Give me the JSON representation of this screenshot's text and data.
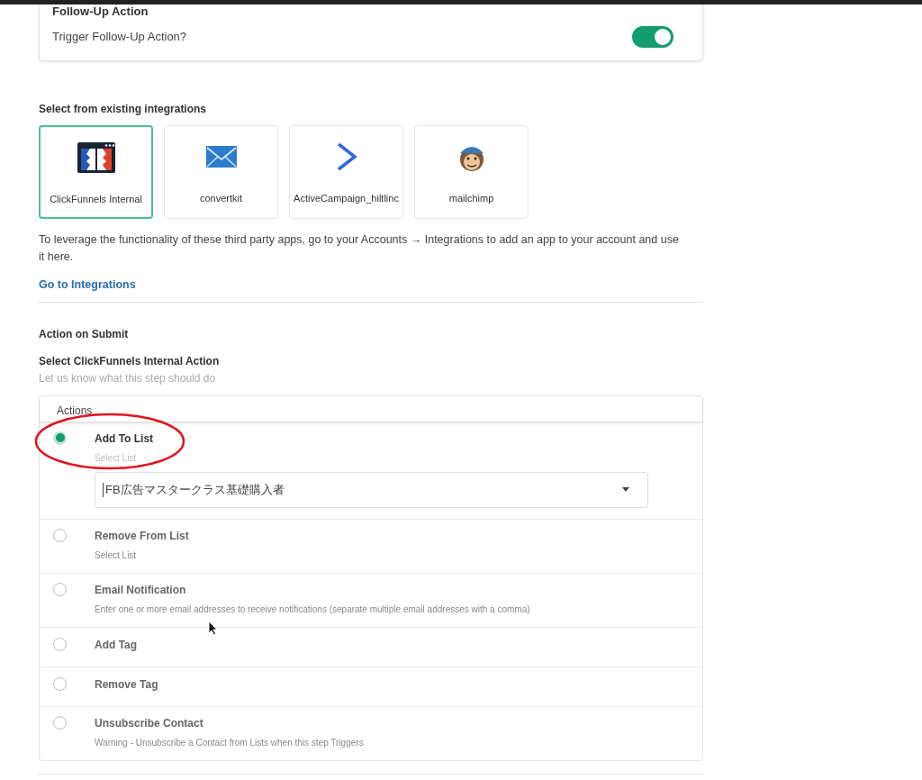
{
  "follow_up": {
    "heading": "Follow-Up Action",
    "label": "Trigger Follow-Up Action?",
    "on": true
  },
  "integrations": {
    "heading": "Select from existing integrations",
    "items": [
      {
        "name": "ClickFunnels Internal",
        "kind": "clickfunnels",
        "selected": true
      },
      {
        "name": "convertkit",
        "kind": "envelope",
        "selected": false
      },
      {
        "name": "ActiveCampaign_hiltlinc",
        "kind": "chevron",
        "selected": false
      },
      {
        "name": "mailchimp",
        "kind": "monkey",
        "selected": false
      }
    ],
    "note": "To leverage the functionality of these third party apps, go to your Accounts → Integrations to add an app to your account and use it here.",
    "link": "Go to Integrations"
  },
  "action_on_submit": {
    "heading": "Action on Submit",
    "title": "Select ClickFunnels Internal Action",
    "hint": "Let us know what this step should do",
    "table_heading": "Actions",
    "actions": [
      {
        "label": "Add To List",
        "hint": "Select List",
        "selected": true,
        "select_value": "FB広告マスタークラス基礎購入者"
      },
      {
        "label": "Remove From List",
        "hint": "Select List",
        "selected": false
      },
      {
        "label": "Email Notification",
        "hint": "Enter one or more email addresses to receive notifications (separate multiple email addresses with a comma)",
        "selected": false
      },
      {
        "label": "Add Tag",
        "selected": false
      },
      {
        "label": "Remove Tag",
        "selected": false
      },
      {
        "label": "Unsubscribe Contact",
        "hint": "Warning - Unsubscribe a Contact from Lists when this step Triggers",
        "selected": false
      }
    ]
  }
}
